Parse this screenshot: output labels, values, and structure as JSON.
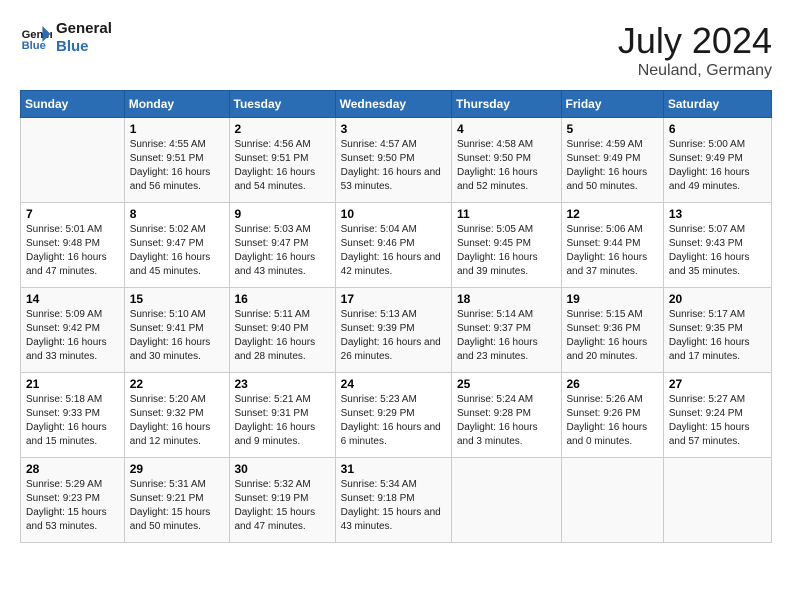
{
  "header": {
    "logo_line1": "General",
    "logo_line2": "Blue",
    "month": "July 2024",
    "location": "Neuland, Germany"
  },
  "days_of_week": [
    "Sunday",
    "Monday",
    "Tuesday",
    "Wednesday",
    "Thursday",
    "Friday",
    "Saturday"
  ],
  "weeks": [
    [
      {
        "day": "",
        "sunrise": "",
        "sunset": "",
        "daylight": ""
      },
      {
        "day": "1",
        "sunrise": "Sunrise: 4:55 AM",
        "sunset": "Sunset: 9:51 PM",
        "daylight": "Daylight: 16 hours and 56 minutes."
      },
      {
        "day": "2",
        "sunrise": "Sunrise: 4:56 AM",
        "sunset": "Sunset: 9:51 PM",
        "daylight": "Daylight: 16 hours and 54 minutes."
      },
      {
        "day": "3",
        "sunrise": "Sunrise: 4:57 AM",
        "sunset": "Sunset: 9:50 PM",
        "daylight": "Daylight: 16 hours and 53 minutes."
      },
      {
        "day": "4",
        "sunrise": "Sunrise: 4:58 AM",
        "sunset": "Sunset: 9:50 PM",
        "daylight": "Daylight: 16 hours and 52 minutes."
      },
      {
        "day": "5",
        "sunrise": "Sunrise: 4:59 AM",
        "sunset": "Sunset: 9:49 PM",
        "daylight": "Daylight: 16 hours and 50 minutes."
      },
      {
        "day": "6",
        "sunrise": "Sunrise: 5:00 AM",
        "sunset": "Sunset: 9:49 PM",
        "daylight": "Daylight: 16 hours and 49 minutes."
      }
    ],
    [
      {
        "day": "7",
        "sunrise": "Sunrise: 5:01 AM",
        "sunset": "Sunset: 9:48 PM",
        "daylight": "Daylight: 16 hours and 47 minutes."
      },
      {
        "day": "8",
        "sunrise": "Sunrise: 5:02 AM",
        "sunset": "Sunset: 9:47 PM",
        "daylight": "Daylight: 16 hours and 45 minutes."
      },
      {
        "day": "9",
        "sunrise": "Sunrise: 5:03 AM",
        "sunset": "Sunset: 9:47 PM",
        "daylight": "Daylight: 16 hours and 43 minutes."
      },
      {
        "day": "10",
        "sunrise": "Sunrise: 5:04 AM",
        "sunset": "Sunset: 9:46 PM",
        "daylight": "Daylight: 16 hours and 42 minutes."
      },
      {
        "day": "11",
        "sunrise": "Sunrise: 5:05 AM",
        "sunset": "Sunset: 9:45 PM",
        "daylight": "Daylight: 16 hours and 39 minutes."
      },
      {
        "day": "12",
        "sunrise": "Sunrise: 5:06 AM",
        "sunset": "Sunset: 9:44 PM",
        "daylight": "Daylight: 16 hours and 37 minutes."
      },
      {
        "day": "13",
        "sunrise": "Sunrise: 5:07 AM",
        "sunset": "Sunset: 9:43 PM",
        "daylight": "Daylight: 16 hours and 35 minutes."
      }
    ],
    [
      {
        "day": "14",
        "sunrise": "Sunrise: 5:09 AM",
        "sunset": "Sunset: 9:42 PM",
        "daylight": "Daylight: 16 hours and 33 minutes."
      },
      {
        "day": "15",
        "sunrise": "Sunrise: 5:10 AM",
        "sunset": "Sunset: 9:41 PM",
        "daylight": "Daylight: 16 hours and 30 minutes."
      },
      {
        "day": "16",
        "sunrise": "Sunrise: 5:11 AM",
        "sunset": "Sunset: 9:40 PM",
        "daylight": "Daylight: 16 hours and 28 minutes."
      },
      {
        "day": "17",
        "sunrise": "Sunrise: 5:13 AM",
        "sunset": "Sunset: 9:39 PM",
        "daylight": "Daylight: 16 hours and 26 minutes."
      },
      {
        "day": "18",
        "sunrise": "Sunrise: 5:14 AM",
        "sunset": "Sunset: 9:37 PM",
        "daylight": "Daylight: 16 hours and 23 minutes."
      },
      {
        "day": "19",
        "sunrise": "Sunrise: 5:15 AM",
        "sunset": "Sunset: 9:36 PM",
        "daylight": "Daylight: 16 hours and 20 minutes."
      },
      {
        "day": "20",
        "sunrise": "Sunrise: 5:17 AM",
        "sunset": "Sunset: 9:35 PM",
        "daylight": "Daylight: 16 hours and 17 minutes."
      }
    ],
    [
      {
        "day": "21",
        "sunrise": "Sunrise: 5:18 AM",
        "sunset": "Sunset: 9:33 PM",
        "daylight": "Daylight: 16 hours and 15 minutes."
      },
      {
        "day": "22",
        "sunrise": "Sunrise: 5:20 AM",
        "sunset": "Sunset: 9:32 PM",
        "daylight": "Daylight: 16 hours and 12 minutes."
      },
      {
        "day": "23",
        "sunrise": "Sunrise: 5:21 AM",
        "sunset": "Sunset: 9:31 PM",
        "daylight": "Daylight: 16 hours and 9 minutes."
      },
      {
        "day": "24",
        "sunrise": "Sunrise: 5:23 AM",
        "sunset": "Sunset: 9:29 PM",
        "daylight": "Daylight: 16 hours and 6 minutes."
      },
      {
        "day": "25",
        "sunrise": "Sunrise: 5:24 AM",
        "sunset": "Sunset: 9:28 PM",
        "daylight": "Daylight: 16 hours and 3 minutes."
      },
      {
        "day": "26",
        "sunrise": "Sunrise: 5:26 AM",
        "sunset": "Sunset: 9:26 PM",
        "daylight": "Daylight: 16 hours and 0 minutes."
      },
      {
        "day": "27",
        "sunrise": "Sunrise: 5:27 AM",
        "sunset": "Sunset: 9:24 PM",
        "daylight": "Daylight: 15 hours and 57 minutes."
      }
    ],
    [
      {
        "day": "28",
        "sunrise": "Sunrise: 5:29 AM",
        "sunset": "Sunset: 9:23 PM",
        "daylight": "Daylight: 15 hours and 53 minutes."
      },
      {
        "day": "29",
        "sunrise": "Sunrise: 5:31 AM",
        "sunset": "Sunset: 9:21 PM",
        "daylight": "Daylight: 15 hours and 50 minutes."
      },
      {
        "day": "30",
        "sunrise": "Sunrise: 5:32 AM",
        "sunset": "Sunset: 9:19 PM",
        "daylight": "Daylight: 15 hours and 47 minutes."
      },
      {
        "day": "31",
        "sunrise": "Sunrise: 5:34 AM",
        "sunset": "Sunset: 9:18 PM",
        "daylight": "Daylight: 15 hours and 43 minutes."
      },
      {
        "day": "",
        "sunrise": "",
        "sunset": "",
        "daylight": ""
      },
      {
        "day": "",
        "sunrise": "",
        "sunset": "",
        "daylight": ""
      },
      {
        "day": "",
        "sunrise": "",
        "sunset": "",
        "daylight": ""
      }
    ]
  ]
}
